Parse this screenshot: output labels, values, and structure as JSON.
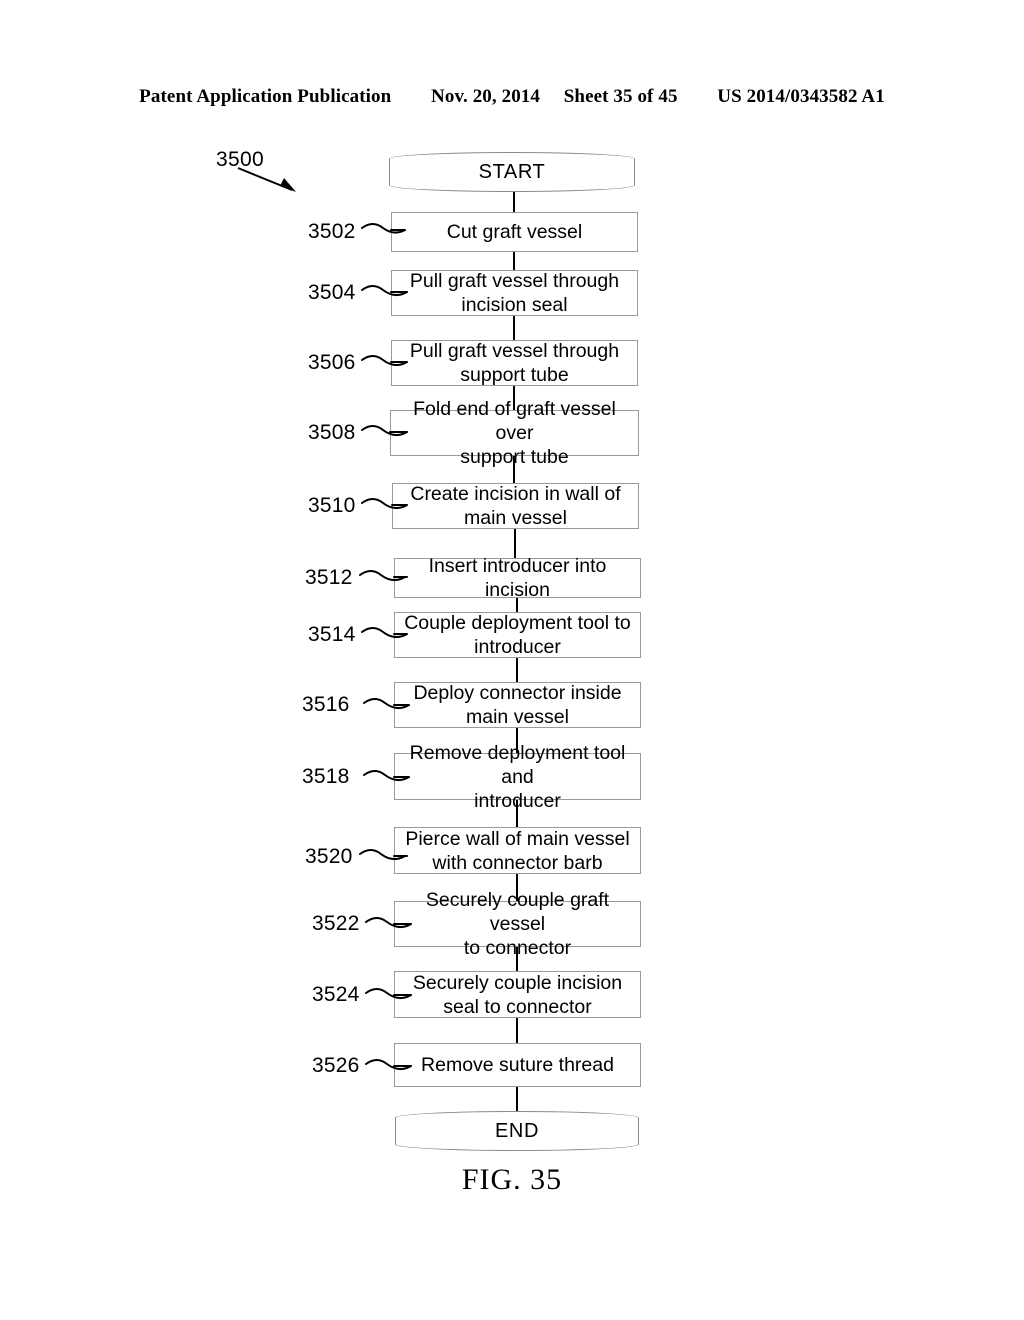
{
  "header": {
    "publication": "Patent Application Publication",
    "date": "Nov. 20, 2014",
    "sheet": "Sheet 35 of 45",
    "docnum": "US 2014/0343582 A1"
  },
  "figure": {
    "caption": "FIG. 35",
    "diagram_ref": "3500"
  },
  "flowchart": {
    "start_label": "START",
    "end_label": "END",
    "steps": [
      {
        "ref": "3502",
        "text": "Cut graft vessel"
      },
      {
        "ref": "3504",
        "text": "Pull graft vessel through\nincision seal"
      },
      {
        "ref": "3506",
        "text": "Pull graft vessel through\nsupport tube"
      },
      {
        "ref": "3508",
        "text": "Fold end of graft vessel over\nsupport tube"
      },
      {
        "ref": "3510",
        "text": "Create incision in wall of\nmain vessel"
      },
      {
        "ref": "3512",
        "text": "Insert introducer into incision"
      },
      {
        "ref": "3514",
        "text": "Couple deployment tool to\nintroducer"
      },
      {
        "ref": "3516",
        "text": "Deploy connector inside\nmain vessel"
      },
      {
        "ref": "3518",
        "text": "Remove deployment tool and\nintroducer"
      },
      {
        "ref": "3520",
        "text": "Pierce wall of main vessel\nwith connector barb"
      },
      {
        "ref": "3522",
        "text": "Securely couple graft vessel\nto connector"
      },
      {
        "ref": "3524",
        "text": "Securely  couple incision\nseal to connector"
      },
      {
        "ref": "3526",
        "text": "Remove suture thread"
      }
    ]
  },
  "colors": {
    "box_border": "#9a9a9a",
    "oval_border": "#8a8a8a",
    "connector": "#000000",
    "text": "#000000",
    "background": "#ffffff"
  }
}
